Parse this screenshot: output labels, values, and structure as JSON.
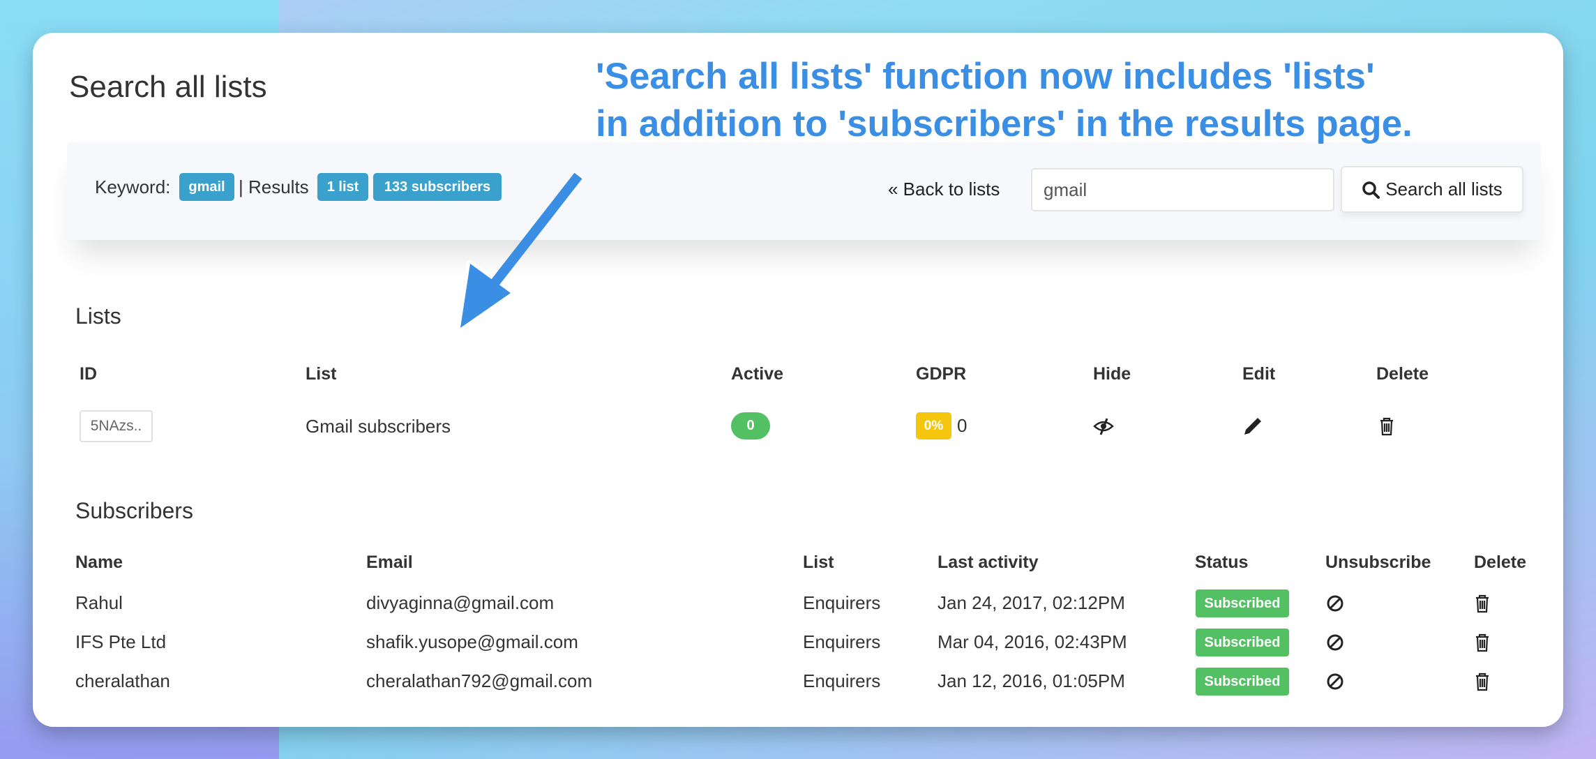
{
  "page_title": "Search all lists",
  "annotation": {
    "line1": "'Search all lists' function now includes 'lists'",
    "line2": "in addition to 'subscribers' in the results page."
  },
  "search_bar": {
    "keyword_label": "Keyword:",
    "keyword": "gmail",
    "results_label": "| Results",
    "lists_count": "1 list",
    "subscribers_count": "133 subscribers",
    "back_link": "« Back to lists",
    "input_value": "gmail",
    "search_button": "Search all lists"
  },
  "lists": {
    "heading": "Lists",
    "columns": [
      "ID",
      "List",
      "Active",
      "GDPR",
      "Hide",
      "Edit",
      "Delete"
    ],
    "rows": [
      {
        "id": "5NAzs..",
        "name": "Gmail subscribers",
        "active": "0",
        "gdpr_percent": "0%",
        "gdpr_count": "0"
      }
    ]
  },
  "subscribers": {
    "heading": "Subscribers",
    "columns": [
      "Name",
      "Email",
      "List",
      "Last activity",
      "Status",
      "Unsubscribe",
      "Delete"
    ],
    "rows": [
      {
        "name": "Rahul",
        "email": "divyaginna@gmail.com",
        "list": "Enquirers",
        "last_activity": "Jan 24, 2017, 02:12PM",
        "status": "Subscribed"
      },
      {
        "name": "IFS Pte Ltd",
        "email": "shafik.yusope@gmail.com",
        "list": "Enquirers",
        "last_activity": "Mar 04, 2016, 02:43PM",
        "status": "Subscribed"
      },
      {
        "name": "cheralathan",
        "email": "cheralathan792@gmail.com",
        "list": "Enquirers",
        "last_activity": "Jan 12, 2016, 01:05PM",
        "status": "Subscribed"
      }
    ]
  },
  "colors": {
    "accent": "#3a8ee3",
    "badge_info": "#3aa1cc",
    "success": "#53c163",
    "warning": "#f5c60e"
  }
}
